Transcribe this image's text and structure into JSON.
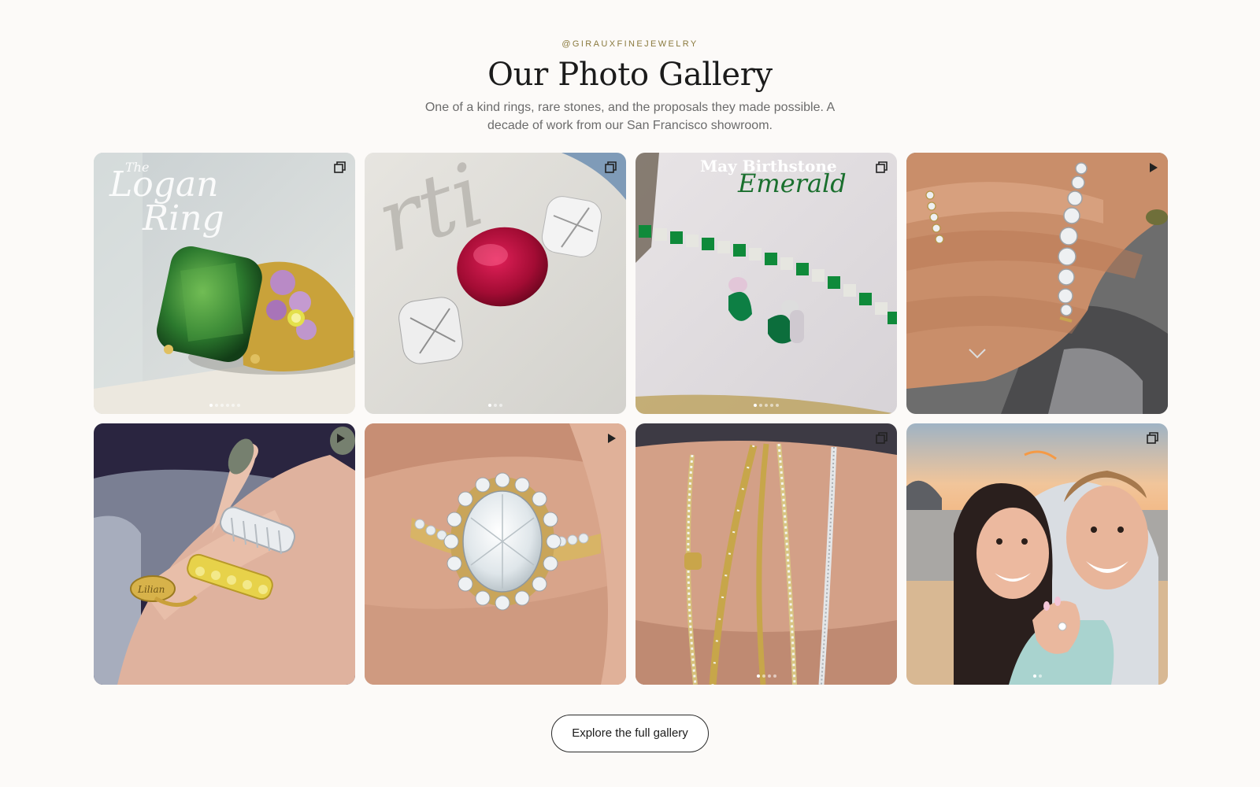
{
  "header": {
    "handle": "@GIRAUXFINEJEWELRY",
    "title": "Our Photo Gallery",
    "subtitle": "One of a kind rings, rare stones, and the proposals they made possible. A decade of work from our San Francisco showroom."
  },
  "gallery": {
    "tiles": [
      {
        "subject": "green tourmaline ring with purple flower accents",
        "overlay_text": "The Logan Ring",
        "badge": "carousel-icon",
        "slides": 6,
        "active_slide": 1
      },
      {
        "subject": "red ruby flanked by two old-mine cut diamonds",
        "overlay_text": "",
        "badge": "carousel-icon",
        "slides": 3,
        "active_slide": 1
      },
      {
        "subject": "emerald tennis bracelet and emerald earrings",
        "overlay_text": "May Birthstone Emerald",
        "overlay_line1": "May Birthstone",
        "overlay_line2": "Emerald",
        "badge": "carousel-icon",
        "slides": 5,
        "active_slide": 1
      },
      {
        "subject": "hand holding bezel-set diamond bracelet",
        "overlay_text": "",
        "badge": "play-icon",
        "slides": 0,
        "active_slide": 0
      },
      {
        "subject": "hand wearing signet ring, yellow diamond band and baguette band",
        "overlay_text": "",
        "badge": "play-icon",
        "slides": 0,
        "active_slide": 0
      },
      {
        "subject": "oval diamond halo engagement ring on finger",
        "overlay_text": "",
        "badge": "play-icon",
        "slides": 0,
        "active_slide": 0
      },
      {
        "subject": "stack of gold and diamond bangles on wrist",
        "overlay_text": "",
        "badge": "carousel-icon",
        "slides": 4,
        "active_slide": 1
      },
      {
        "subject": "engaged couple selfie at sunset beach",
        "overlay_text": "",
        "badge": "carousel-icon",
        "slides": 2,
        "active_slide": 1
      }
    ]
  },
  "cta": {
    "label": "Explore the full gallery"
  },
  "colors": {
    "accent_handle": "#8a7a3e",
    "background": "#fcfaf8",
    "text_muted": "#6b6b6b"
  }
}
